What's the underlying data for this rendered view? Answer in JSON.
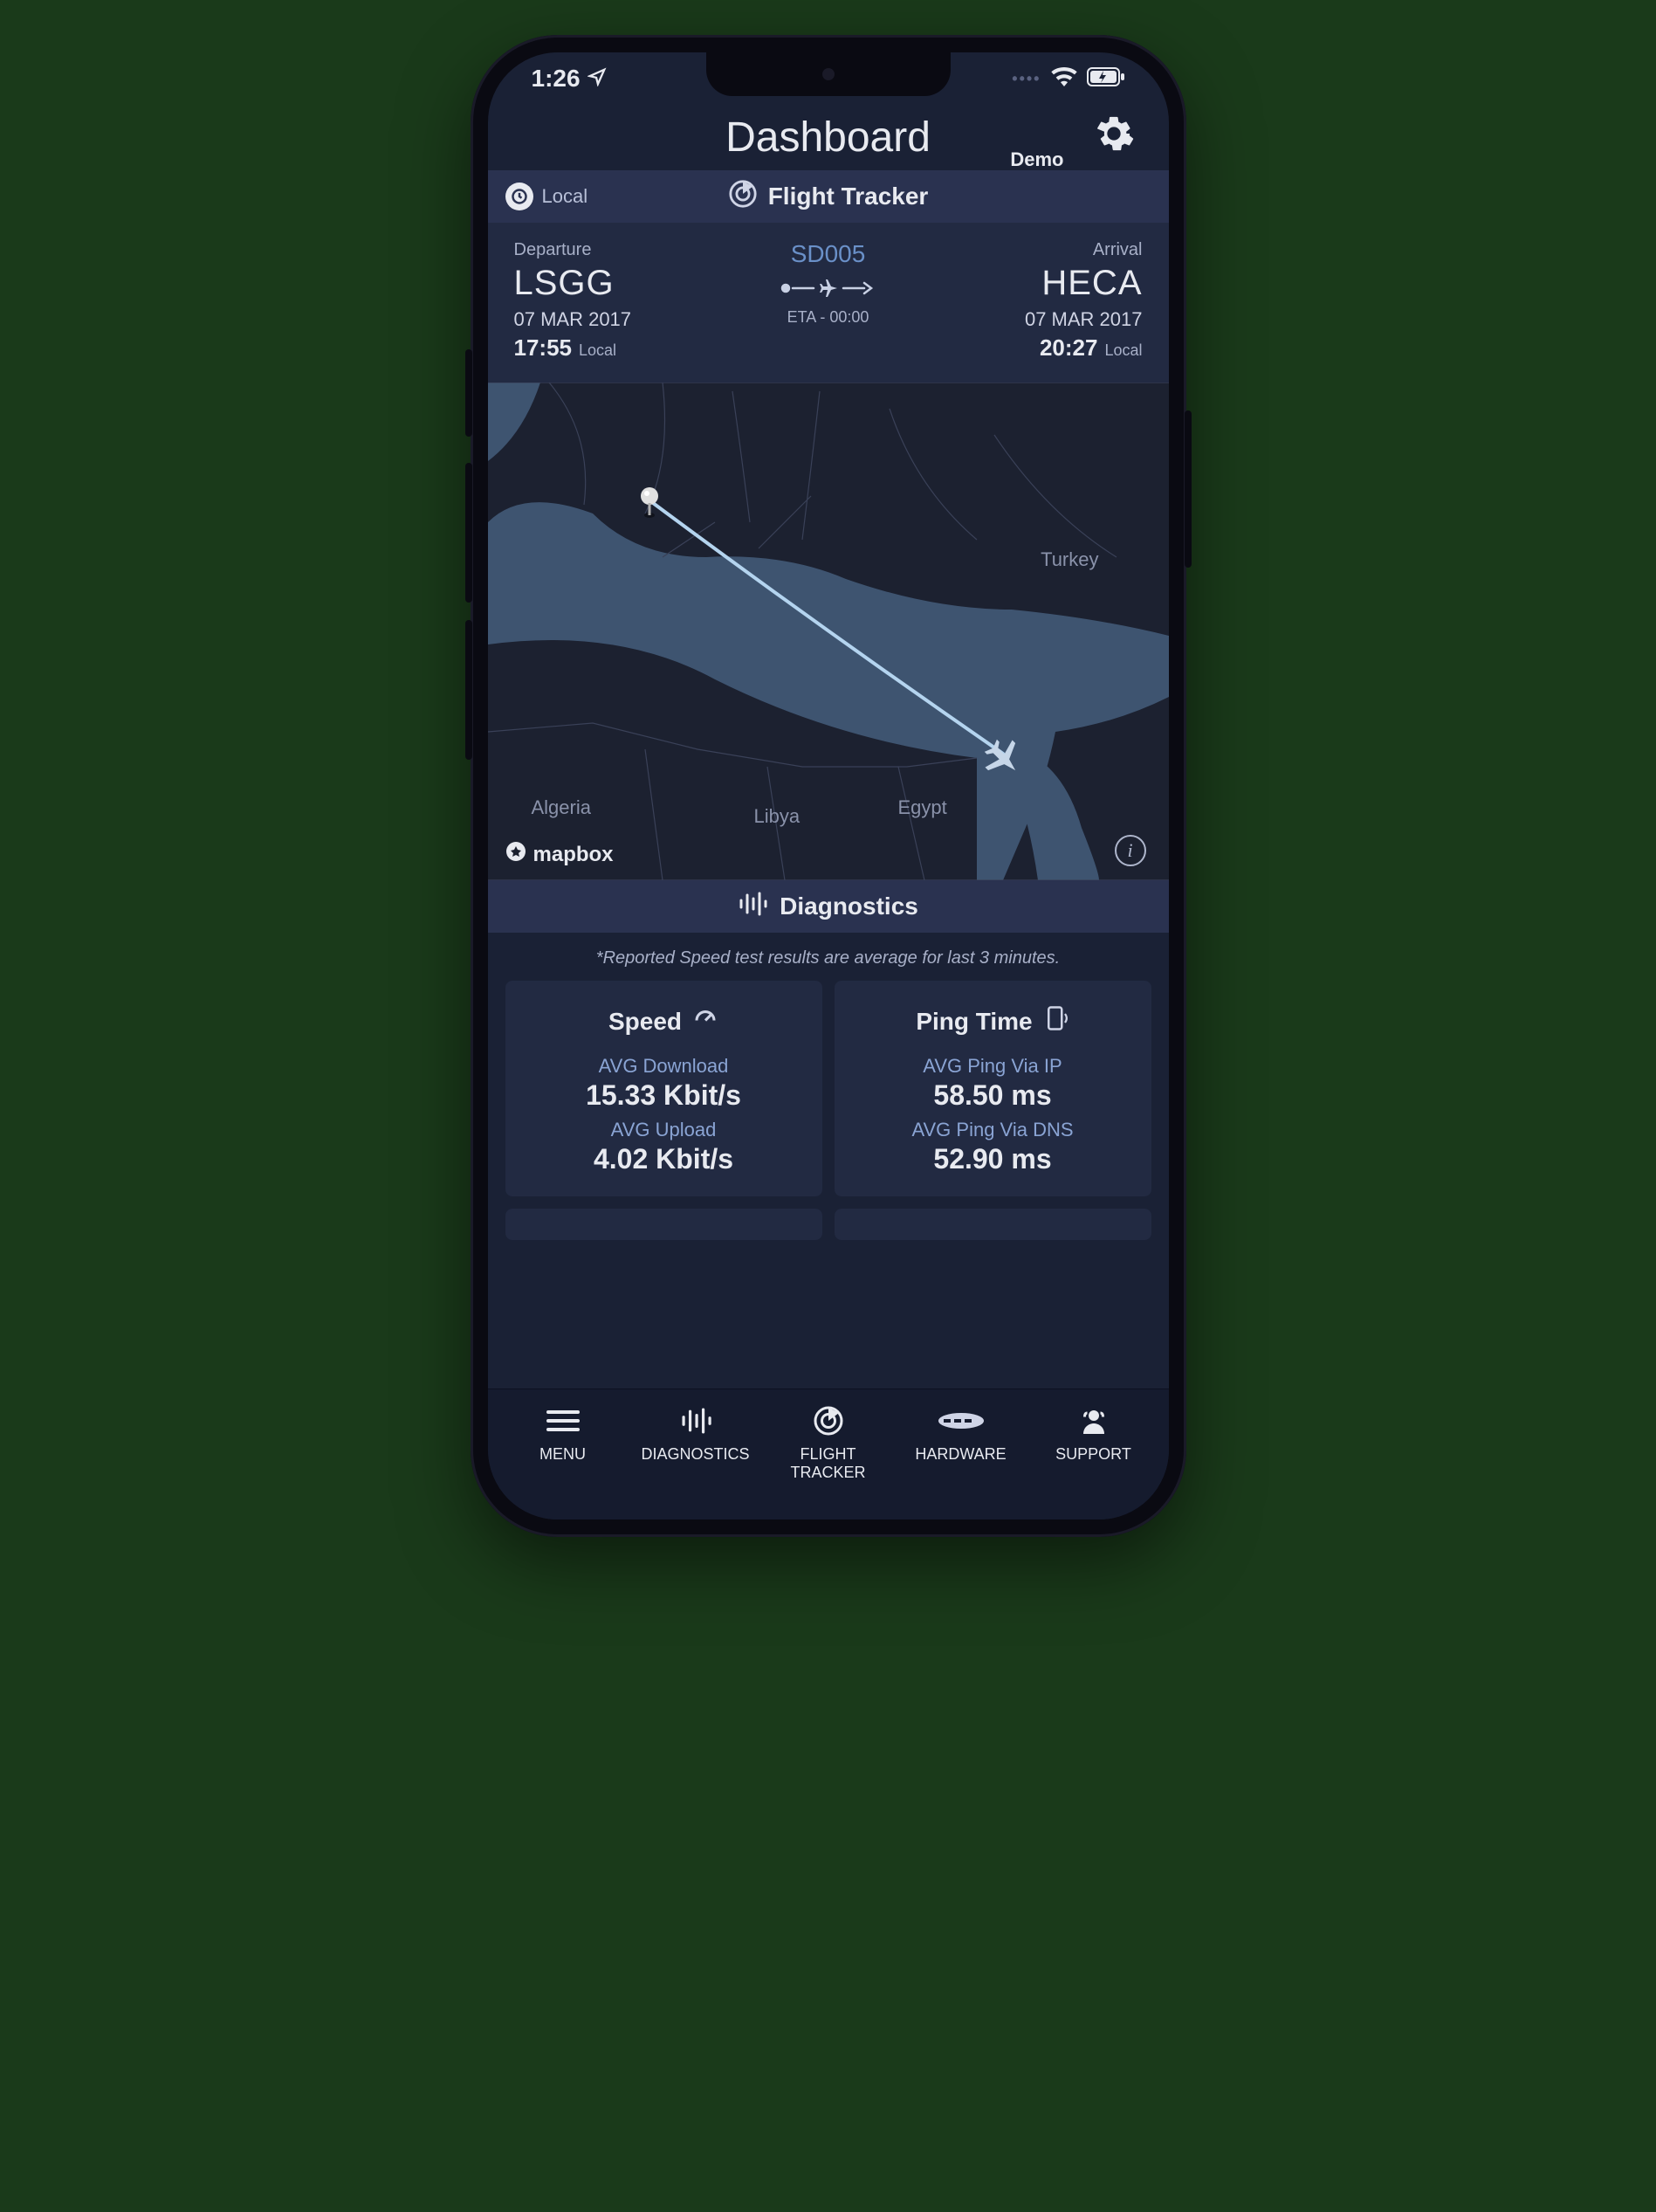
{
  "status": {
    "time": "1:26"
  },
  "header": {
    "title": "Dashboard",
    "demo": "Demo"
  },
  "tracker": {
    "tz_label": "Local",
    "title": "Flight Tracker"
  },
  "flight": {
    "dep_label": "Departure",
    "dep_code": "LSGG",
    "dep_date": "07 MAR 2017",
    "dep_time": "17:55",
    "dep_tz": "Local",
    "flight_no": "SD005",
    "eta": "ETA - 00:00",
    "arr_label": "Arrival",
    "arr_code": "HECA",
    "arr_date": "07 MAR 2017",
    "arr_time": "20:27",
    "arr_tz": "Local"
  },
  "map": {
    "attribution": "mapbox",
    "countries": {
      "algeria": "Algeria",
      "libya": "Libya",
      "egypt": "Egypt",
      "turkey": "Turkey"
    }
  },
  "diagnostics": {
    "title": "Diagnostics",
    "hint": "*Reported Speed test results are average for last 3 minutes.",
    "speed": {
      "title": "Speed",
      "dl_label": "AVG Download",
      "dl_value": "15.33 Kbit/s",
      "ul_label": "AVG Upload",
      "ul_value": "4.02 Kbit/s"
    },
    "ping": {
      "title": "Ping Time",
      "ip_label": "AVG Ping Via IP",
      "ip_value": "58.50 ms",
      "dns_label": "AVG Ping Via DNS",
      "dns_value": "52.90 ms"
    }
  },
  "tabs": {
    "menu": "MENU",
    "diagnostics": "DIAGNOSTICS",
    "tracker": "FLIGHT TRACKER",
    "hardware": "HARDWARE",
    "support": "SUPPORT"
  }
}
